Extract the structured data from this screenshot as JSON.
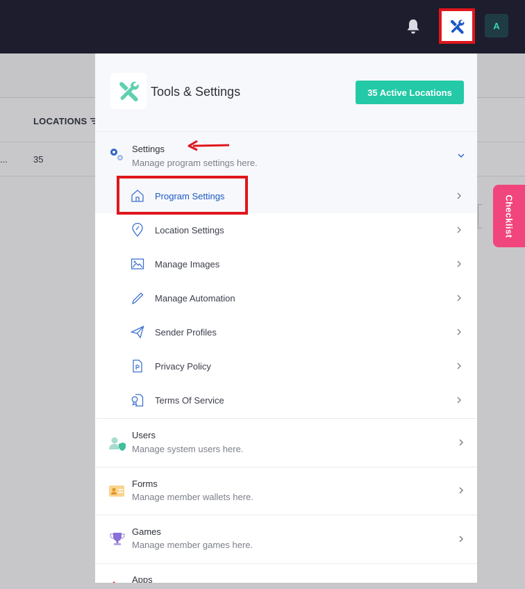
{
  "topbar": {
    "bell_icon": "bell-icon",
    "tools_icon": "tools-icon",
    "avatar_initial": "A"
  },
  "background": {
    "column_header": "LOCATIONS",
    "row_ellipsis": "...",
    "row_value": "35",
    "checklist_label": "Checklist"
  },
  "panel": {
    "title": "Tools & Settings",
    "active_locations": "35 Active Locations",
    "sections": {
      "settings": {
        "title": "Settings",
        "subtitle": "Manage program settings here."
      },
      "users": {
        "title": "Users",
        "subtitle": "Manage system users here."
      },
      "forms": {
        "title": "Forms",
        "subtitle": "Manage member wallets here."
      },
      "games": {
        "title": "Games",
        "subtitle": "Manage member games here."
      },
      "apps": {
        "title": "Apps"
      }
    },
    "settings_items": [
      {
        "label": "Program Settings",
        "icon": "home-icon"
      },
      {
        "label": "Location Settings",
        "icon": "location-pin-icon"
      },
      {
        "label": "Manage Images",
        "icon": "image-icon"
      },
      {
        "label": "Manage Automation",
        "icon": "pencil-icon"
      },
      {
        "label": "Sender Profiles",
        "icon": "paper-plane-icon"
      },
      {
        "label": "Privacy Policy",
        "icon": "document-p-icon"
      },
      {
        "label": "Terms Of Service",
        "icon": "terms-document-icon"
      }
    ]
  },
  "colors": {
    "topbar": "#1d1d2d",
    "accent_teal": "#24c9a7",
    "active_blue": "#1b58c5",
    "highlight_red": "#e0161b",
    "checklist_pink": "#f0457d"
  }
}
